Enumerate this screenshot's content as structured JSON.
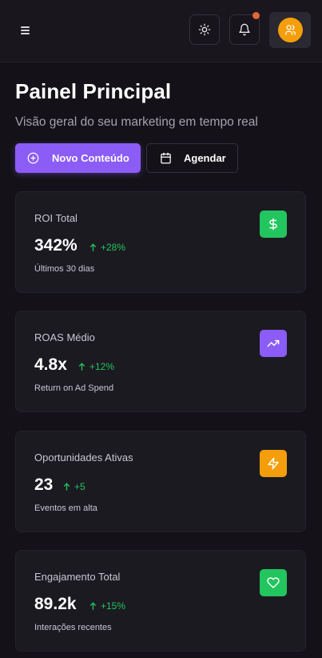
{
  "header": {
    "menu_icon": "menu-icon",
    "theme_icon": "sun-icon",
    "notification_icon": "bell-icon",
    "user_icon": "users-icon"
  },
  "page": {
    "title": "Painel Principal",
    "subtitle": "Visão geral do seu marketing em tempo real"
  },
  "actions": {
    "primary_label": "Novo Conteúdo",
    "secondary_label": "Agendar"
  },
  "colors": {
    "accent": "#8b5cf6",
    "positive": "#22c55e",
    "roi_icon_bg": "#22c55e",
    "roas_icon_bg": "#8b5cf6",
    "opportunities_icon_bg": "#f59e0b",
    "engagement_icon_bg": "#22c55e",
    "avatar_bg": "#f59e0b"
  },
  "metrics": [
    {
      "label": "ROI Total",
      "value": "342%",
      "change": "+28%",
      "caption": "Últimos 30 dias",
      "icon": "dollar-icon"
    },
    {
      "label": "ROAS Médio",
      "value": "4.8x",
      "change": "+12%",
      "caption": "Return on Ad Spend",
      "icon": "trending-up-icon"
    },
    {
      "label": "Oportunidades Ativas",
      "value": "23",
      "change": "+5",
      "caption": "Eventos em alta",
      "icon": "zap-icon"
    },
    {
      "label": "Engajamento Total",
      "value": "89.2k",
      "change": "+15%",
      "caption": "Interações recentes",
      "icon": "heart-icon"
    }
  ]
}
